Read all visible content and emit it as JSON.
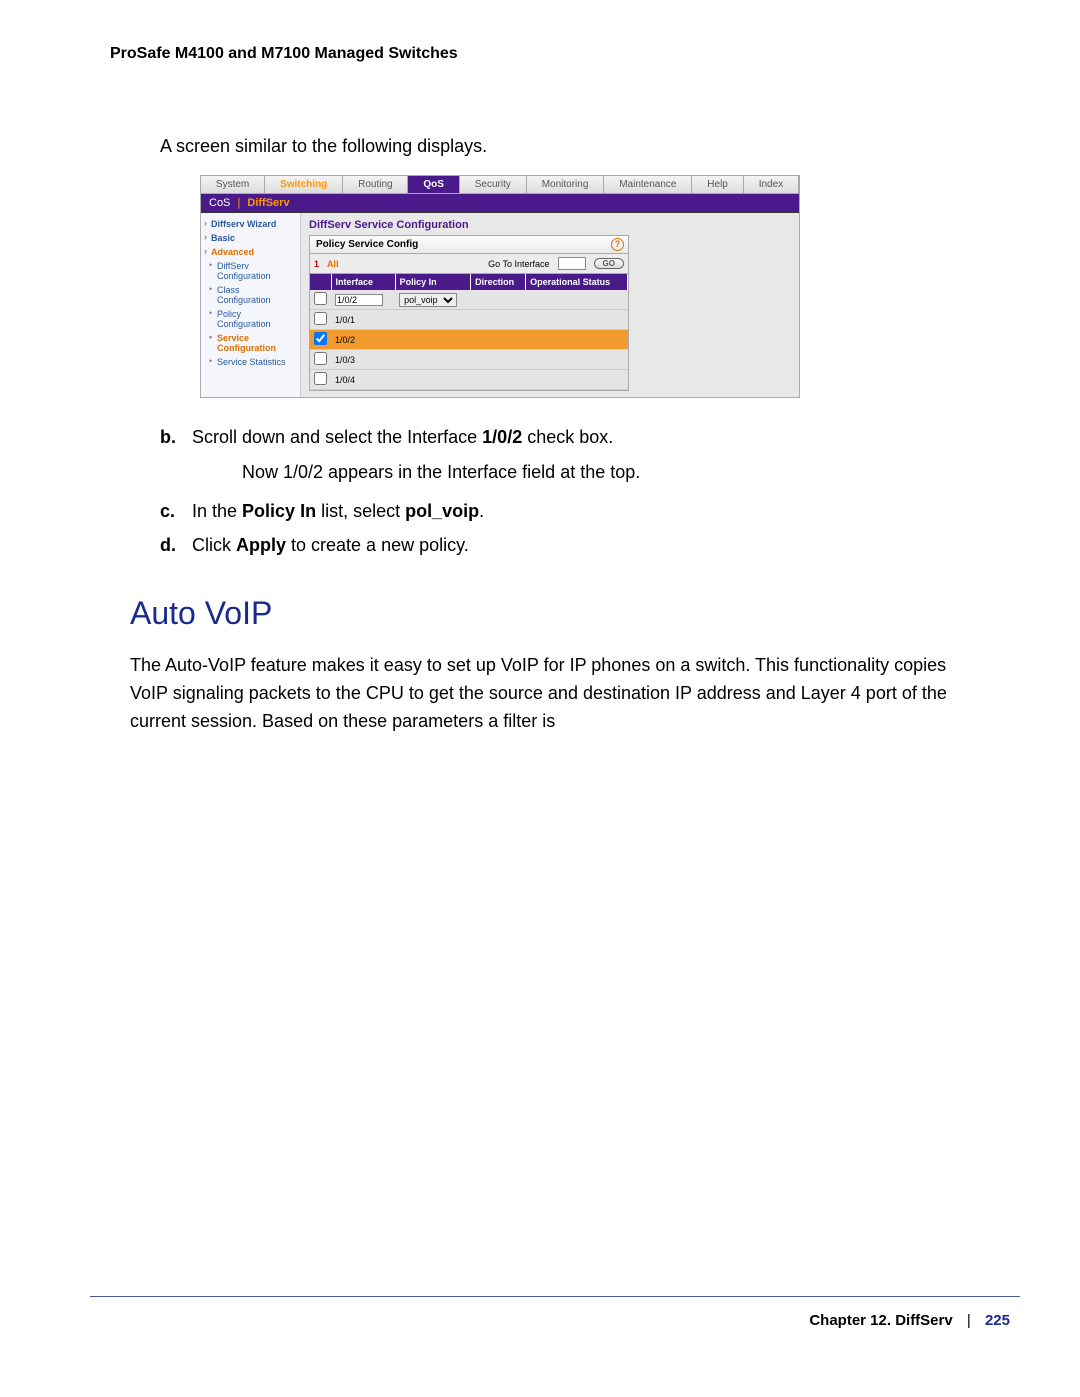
{
  "header": {
    "title": "ProSafe M4100 and M7100 Managed Switches"
  },
  "intro": "A screen similar to the following displays.",
  "screenshot": {
    "topnav": [
      {
        "label": "System"
      },
      {
        "label": "Switching",
        "cls": "active-switching"
      },
      {
        "label": "Routing"
      },
      {
        "label": "QoS",
        "cls": "active-qos"
      },
      {
        "label": "Security"
      },
      {
        "label": "Monitoring"
      },
      {
        "label": "Maintenance"
      },
      {
        "label": "Help"
      },
      {
        "label": "Index"
      }
    ],
    "subbar": {
      "a": "CoS",
      "b": "DiffServ"
    },
    "sidebar": [
      {
        "label": "Diffserv Wizard",
        "cls": "bold"
      },
      {
        "label": "Basic",
        "cls": "bold"
      },
      {
        "label": "Advanced",
        "cls": "orange"
      },
      {
        "label": "DiffServ Configuration",
        "cls": "lvl2"
      },
      {
        "label": "Class Configuration",
        "cls": "lvl2"
      },
      {
        "label": "Policy Configuration",
        "cls": "lvl2"
      },
      {
        "label": "Service Configuration",
        "cls": "lvl2 orange"
      },
      {
        "label": "Service Statistics",
        "cls": "lvl2"
      }
    ],
    "panel_title": "DiffServ Service Configuration",
    "grid_title": "Policy Service Config",
    "filter": {
      "one": "1",
      "all": "All",
      "goto": "Go To Interface",
      "go": "GO"
    },
    "cols": {
      "c1": "Interface",
      "c2": "Policy In",
      "c3": "Direction",
      "c4": "Operational Status"
    },
    "edit": {
      "iface": "1/0/2",
      "policy": "pol_voip"
    },
    "rows": [
      {
        "iface": "1/0/1",
        "checked": false,
        "sel": false
      },
      {
        "iface": "1/0/2",
        "checked": true,
        "sel": true
      },
      {
        "iface": "1/0/3",
        "checked": false,
        "sel": false
      },
      {
        "iface": "1/0/4",
        "checked": false,
        "sel": false
      }
    ]
  },
  "steps": {
    "b_marker": "b.",
    "b_text_pre": "Scroll down and select the Interface ",
    "b_bold": "1/0/2",
    "b_text_post": " check box.",
    "b_sub": "Now 1/0/2 appears in the Interface field at the top.",
    "c_marker": "c.",
    "c_pre": "In the ",
    "c_b1": "Policy In",
    "c_mid": " list, select ",
    "c_b2": "pol_voip",
    "c_post": ".",
    "d_marker": "d.",
    "d_pre": "Click ",
    "d_b": "Apply",
    "d_post": " to create a new policy."
  },
  "heading": "Auto VoIP",
  "paragraph": "The Auto-VoIP feature makes it easy to set up VoIP for IP phones on a switch. This functionality copies VoIP signaling packets to the CPU to get the source and destination IP address and Layer 4 port of the current session. Based on these parameters a filter is",
  "footer": {
    "chapter": "Chapter 12.  DiffServ",
    "page": "225"
  }
}
